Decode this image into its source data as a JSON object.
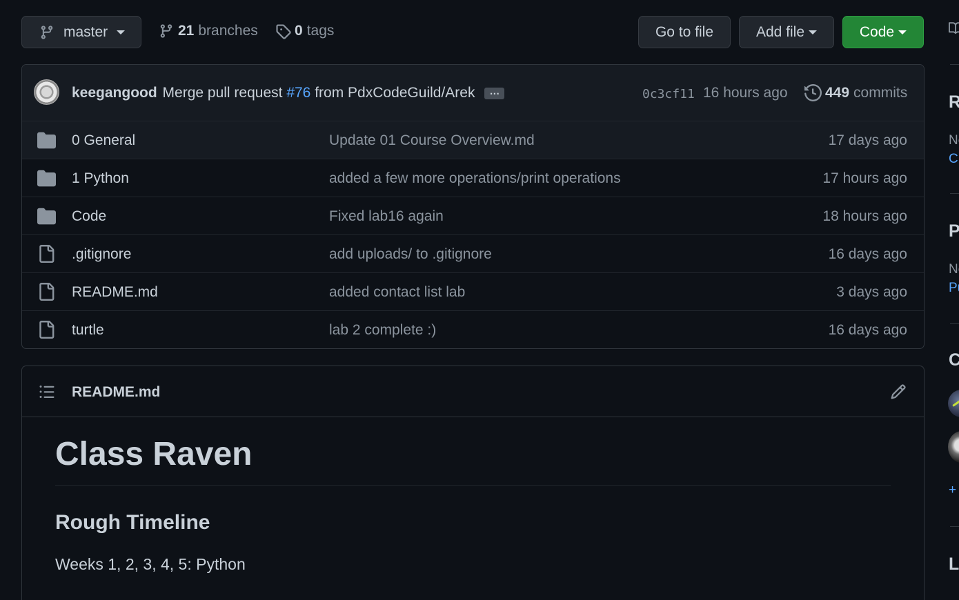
{
  "toolbar": {
    "branch": "master",
    "branches_count": "21",
    "branches_label": "branches",
    "tags_count": "0",
    "tags_label": "tags",
    "goto_file": "Go to file",
    "add_file": "Add file",
    "code": "Code"
  },
  "commit": {
    "author": "keegangood",
    "message_prefix": "Merge pull request",
    "pr_number": "#76",
    "message_suffix": "from PdxCodeGuild/Arek",
    "ellipsis": "…",
    "sha": "0c3cf11",
    "time": "16 hours ago",
    "commit_count": "449",
    "commits_label": "commits"
  },
  "files": [
    {
      "type": "folder",
      "name": "0 General",
      "message": "Update 01 Course Overview.md",
      "age": "17 days ago"
    },
    {
      "type": "folder",
      "name": "1 Python",
      "message": "added a few more operations/print operations",
      "age": "17 hours ago"
    },
    {
      "type": "folder",
      "name": "Code",
      "message": "Fixed lab16 again",
      "age": "18 hours ago"
    },
    {
      "type": "file",
      "name": ".gitignore",
      "message": "add uploads/ to .gitignore",
      "age": "16 days ago"
    },
    {
      "type": "file",
      "name": "README.md",
      "message": "added contact list lab",
      "age": "3 days ago"
    },
    {
      "type": "file",
      "name": "turtle",
      "message": "lab 2 complete :)",
      "age": "16 days ago"
    }
  ],
  "readme": {
    "filename": "README.md",
    "h1": "Class Raven",
    "h2": "Rough Timeline",
    "line1": "Weeks 1, 2, 3, 4, 5: Python"
  },
  "sidebar": {
    "about_initial": "R",
    "about_line1": "Ne",
    "about_link": "Cr",
    "packages_initial": "P",
    "packages_line1": "Ne",
    "packages_link": "Pu",
    "contributors_initial": "C",
    "more_link": "+",
    "languages_initial": "L"
  },
  "colors": {
    "background": "#0d1117",
    "code_button": "#238636",
    "link": "#58a6ff"
  }
}
